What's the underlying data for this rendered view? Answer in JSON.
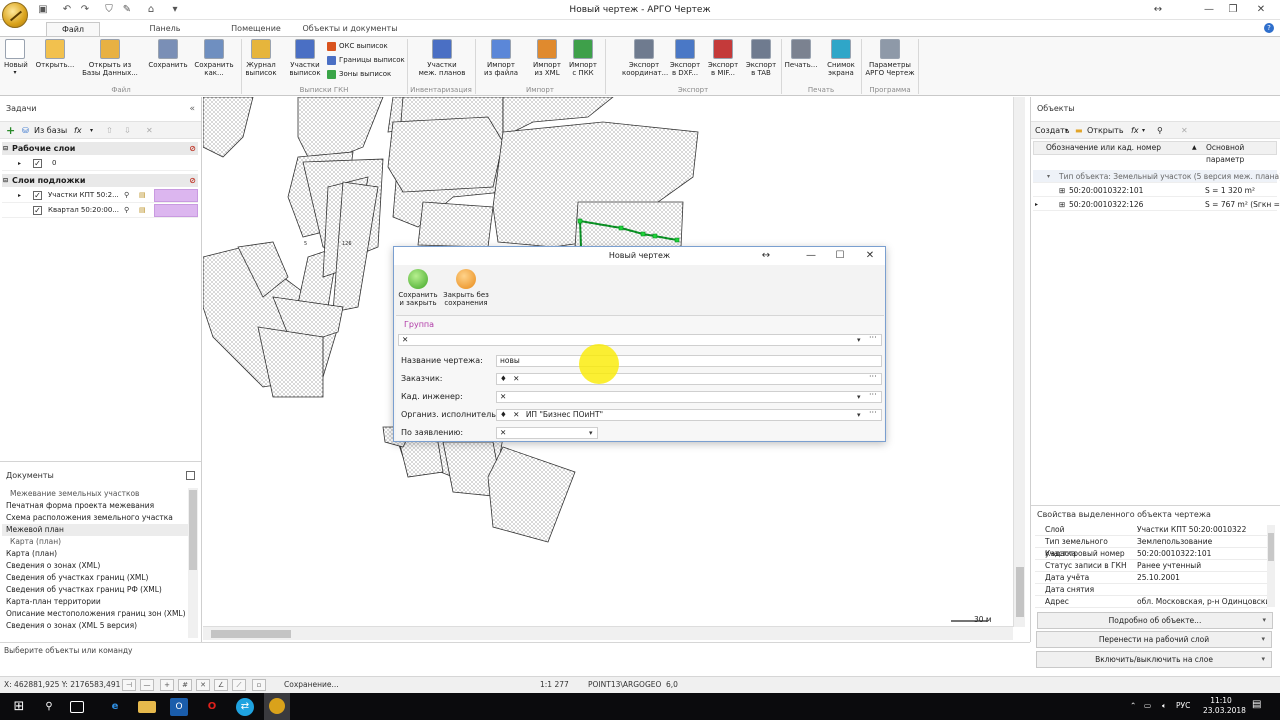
{
  "window": {
    "title": "Новый чертеж - АРГО Чертеж"
  },
  "ribbon": {
    "tabs": [
      "Файл",
      "Панель инструментов",
      "Помещение",
      "Объекты и документы"
    ],
    "buttons": [
      {
        "label": "Новый",
        "caret": "▾",
        "icon": "new-doc-icon",
        "color": "#ffffff"
      },
      {
        "label": "Открыть...",
        "icon": "folder-open-icon",
        "color": "#f2c14e"
      },
      {
        "label": "Открыть из\nБазы Данных...",
        "icon": "database-folder-icon",
        "color": "#e8b143"
      },
      {
        "label": "Сохранить",
        "icon": "save-icon",
        "color": "#7a8fb6"
      },
      {
        "label": "Сохранить\nкак...",
        "icon": "save-as-icon",
        "color": "#6f8fc0"
      },
      {
        "label": "Журнал\nвыписок",
        "icon": "journal-icon",
        "color": "#e6b53c"
      },
      {
        "label": "Участки\nвыписок",
        "icon": "parcels-grid-icon",
        "color": "#4a6fc4"
      },
      {
        "label": "Участки\nмеж. планов",
        "icon": "plan-grid-icon",
        "color": "#4a6fc4"
      },
      {
        "label": "Импорт\nиз файла",
        "icon": "import-file-icon",
        "color": "#5b87d8"
      },
      {
        "label": "Импорт\nиз XML",
        "icon": "import-xml-icon",
        "color": "#e08a2e"
      },
      {
        "label": "Импорт\nс ПКК",
        "icon": "import-globe-icon",
        "color": "#3ea04a"
      },
      {
        "label": "Экспорт\nкоординат...",
        "icon": "export-coords-icon",
        "color": "#6f7b8f"
      },
      {
        "label": "Экспорт\nв DXF...",
        "icon": "export-dxf-icon",
        "color": "#4a78c6"
      },
      {
        "label": "Экспорт\nв MIF...",
        "icon": "export-mif-icon",
        "color": "#c43a3a"
      },
      {
        "label": "Экспорт\nв TAB",
        "icon": "export-tab-icon",
        "color": "#6f7b8f"
      },
      {
        "label": "Печать...",
        "icon": "printer-icon",
        "color": "#7b8290"
      },
      {
        "label": "Снимок\nэкрана",
        "icon": "screenshot-icon",
        "color": "#2fa6c8"
      },
      {
        "label": "Параметры\nАРГО Чертеж",
        "icon": "gear-icon",
        "color": "#8e99a8"
      }
    ],
    "small_buttons": [
      {
        "label": "ОКС выписок",
        "icon": "oks-icon",
        "color": "#d9531e"
      },
      {
        "label": "Границы выписок",
        "icon": "borders-icon",
        "color": "#4a6fc4"
      },
      {
        "label": "Зоны выписок",
        "icon": "zones-icon",
        "color": "#3aa548"
      }
    ],
    "groups": [
      "Файл",
      "Выписки ГКН",
      "Инвентаризация",
      "Импорт",
      "Экспорт",
      "Печать",
      "Программа"
    ]
  },
  "left": {
    "tasks_title": "Задачи",
    "toolbar": {
      "from_db": "Из базы",
      "fx": "fx"
    },
    "working_layers": {
      "title": "Рабочие слои",
      "rows": [
        {
          "name": "0"
        }
      ]
    },
    "underlay_layers": {
      "title": "Слои подложки",
      "rows": [
        {
          "name": "Участки КПТ 50:2..."
        },
        {
          "name": "Квартал 50:20:00..."
        }
      ]
    },
    "documents_title": "Документы",
    "documents": [
      {
        "text": "Межевание земельных участков",
        "section": true
      },
      {
        "text": "Печатная форма проекта межевания"
      },
      {
        "text": "Схема расположения земельного участка"
      },
      {
        "text": "Межевой план",
        "selected": true
      },
      {
        "text": "Карта (план)",
        "section": true
      },
      {
        "text": "Карта (план)"
      },
      {
        "text": "Сведения о зонах (XML)"
      },
      {
        "text": "Сведения об участках границ (XML)"
      },
      {
        "text": "Сведения об участках границ РФ (XML)"
      },
      {
        "text": "Карта-план территории"
      },
      {
        "text": "Описание местоположения границ зон (XML)"
      },
      {
        "text": "Сведения о зонах (XML 5 версия)"
      }
    ]
  },
  "map": {
    "labels": [
      "5",
      "126"
    ],
    "scale": "30 м"
  },
  "dialog": {
    "title": "Новый чертеж",
    "save_close": "Сохранить\nи закрыть",
    "close_nosave": "Закрыть без\nсохранения",
    "group_label": "Группа",
    "fields": [
      {
        "label": "Название чертежа:",
        "value": "новы"
      },
      {
        "label": "Заказчик:",
        "value": ""
      },
      {
        "label": "Кад. инженер:",
        "value": ""
      },
      {
        "label": "Организ. исполнитель:",
        "value": "ИП \"Бизнес ПОиНТ\""
      },
      {
        "label": "По заявлению:",
        "value": ""
      }
    ]
  },
  "right": {
    "objects_title": "Объекты",
    "toolbar": {
      "create": "Создать",
      "open": "Открыть"
    },
    "columns": [
      "Обозначение или кад. номер",
      "Основной параметр"
    ],
    "group_row": "Тип объекта: Земельный участок (5 версия меж. плана)",
    "rows": [
      {
        "id": "50:20:0010322:101",
        "param": "S = 1 320 m²"
      },
      {
        "id": "50:20:0010322:126",
        "param": "S = 767 m² (Sгкн =..."
      }
    ],
    "props_title": "Свойства выделенного объекта чертежа",
    "props": [
      {
        "k": "Слой",
        "v": "Участки КПТ 50:20:0010322"
      },
      {
        "k": "Тип земельного участка",
        "v": "Землепользование"
      },
      {
        "k": "Кадастровый номер",
        "v": "50:20:0010322:101"
      },
      {
        "k": "Статус записи в ГКН",
        "v": "Ранее учтенный"
      },
      {
        "k": "Дата учёта",
        "v": "25.10.2001"
      },
      {
        "k": "Дата снятия",
        "v": ""
      },
      {
        "k": "Адрес",
        "v": "обл. Московская, р-н Одинцовский, д. Марьинский, ..."
      }
    ],
    "buttons": [
      "Подробно об объекте...",
      "Перенести на рабочий слой",
      "Включить/выключить на слое"
    ]
  },
  "command": {
    "prompt": "Выберите объекты или команду"
  },
  "status": {
    "coords": "X: 462881,925 Y: 2176583,491",
    "saving": "Сохранение...",
    "scale": "1:1 277",
    "point": "POINT13\\ARGOGEO",
    "value": "6,0"
  },
  "taskbar": {
    "lang": "РУС",
    "time": "11:10",
    "date": "23.03.2018"
  }
}
